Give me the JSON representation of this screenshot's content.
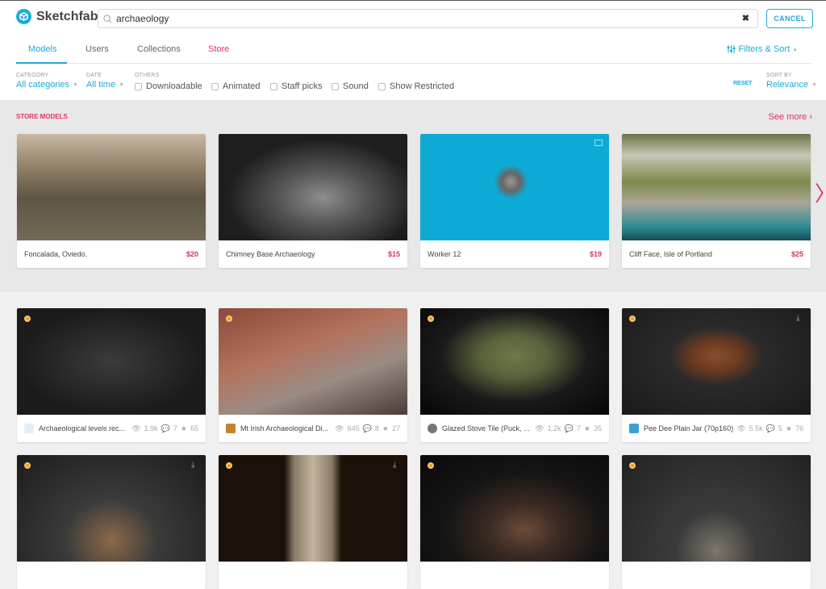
{
  "app": {
    "name": "Sketchfab"
  },
  "search": {
    "value": "archaeology",
    "clear_icon": "close-icon",
    "cancel_label": "CANCEL"
  },
  "tabs": [
    {
      "label": "Models",
      "active": true
    },
    {
      "label": "Users"
    },
    {
      "label": "Collections"
    },
    {
      "label": "Store"
    }
  ],
  "filters_sort": {
    "label": "Filters & Sort"
  },
  "filters": {
    "category": {
      "label": "CATEGORY",
      "value": "All categories"
    },
    "date": {
      "label": "DATE",
      "value": "All time"
    },
    "others": {
      "label": "OTHERS"
    },
    "checkboxes": [
      "Downloadable",
      "Animated",
      "Staff picks",
      "Sound",
      "Show Restricted"
    ],
    "reset_label": "RESET",
    "sort": {
      "label": "SORT BY",
      "value": "Relevance"
    }
  },
  "store": {
    "title": "STORE MODELS",
    "see_more": "See more ›",
    "items": [
      {
        "name": "Foncalada, Oviedo.",
        "price": "$20"
      },
      {
        "name": "Chimney Base Archaeology",
        "price": "$15"
      },
      {
        "name": "Worker 12",
        "price": "$19"
      },
      {
        "name": "Cliff Face, Isle of Portland",
        "price": "$25"
      }
    ]
  },
  "models": [
    {
      "name": "Archaeological levels rec...",
      "views": "1.9k",
      "comments": "7",
      "likes": "65"
    },
    {
      "name": "Mt Irish Archaeological Di...",
      "views": "645",
      "comments": "8",
      "likes": "27"
    },
    {
      "name": "Glazed Stove Tile (Puck, ...",
      "views": "1.2k",
      "comments": "7",
      "likes": "35"
    },
    {
      "name": "Pee Dee Plain Jar (70p160)",
      "views": "5.5k",
      "comments": "5",
      "likes": "76"
    }
  ],
  "colors": {
    "accent": "#1caad9",
    "store": "#e5305f",
    "staff_badge": "#f39c12"
  }
}
